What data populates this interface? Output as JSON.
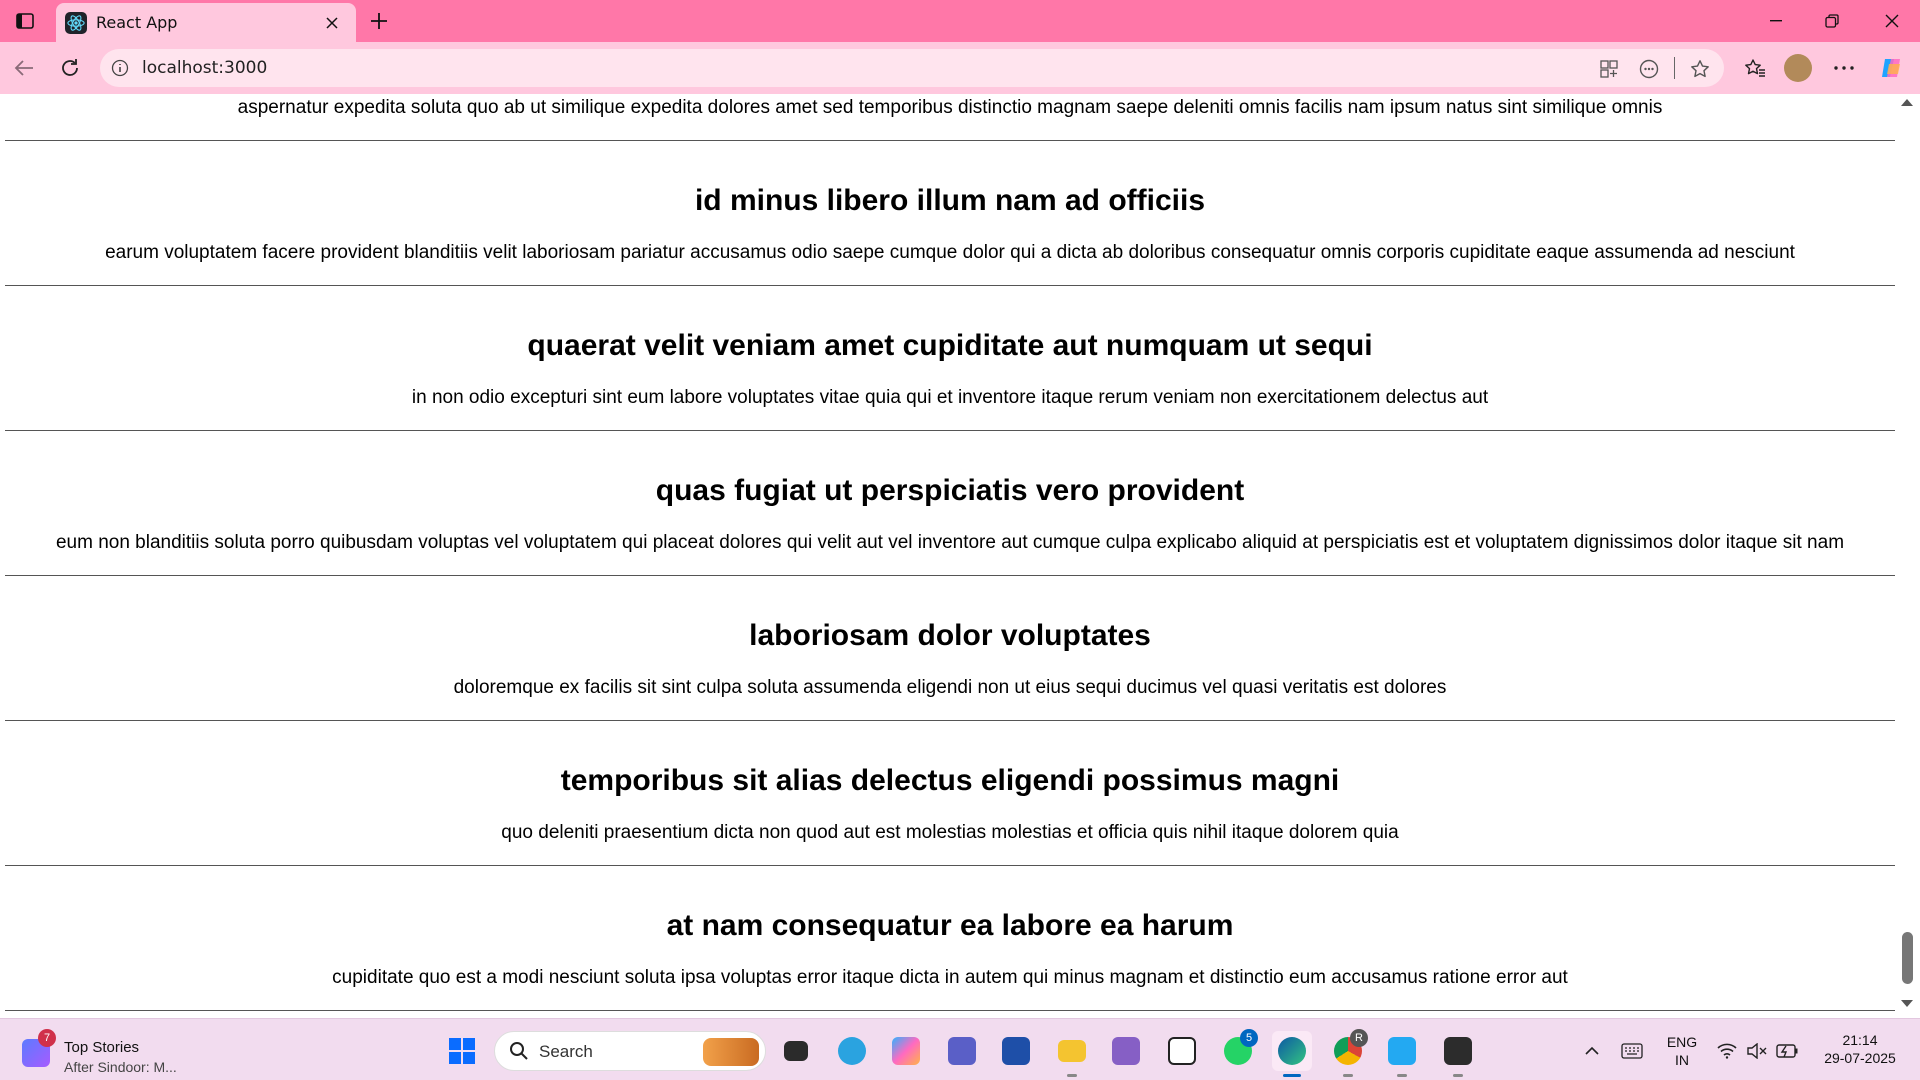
{
  "browser": {
    "tab_title": "React App",
    "url": "localhost:3000"
  },
  "posts": [
    {
      "title": "",
      "body": "aspernatur expedita soluta quo ab ut similique expedita dolores amet sed temporibus distinctio magnam saepe deleniti omnis facilis nam ipsum natus sint similique omnis"
    },
    {
      "title": "id minus libero illum nam ad officiis",
      "body": "earum voluptatem facere provident blanditiis velit laboriosam pariatur accusamus odio saepe cumque dolor qui a dicta ab doloribus consequatur omnis corporis cupiditate eaque assumenda ad nesciunt"
    },
    {
      "title": "quaerat velit veniam amet cupiditate aut numquam ut sequi",
      "body": "in non odio excepturi sint eum labore voluptates vitae quia qui et inventore itaque rerum veniam non exercitationem delectus aut"
    },
    {
      "title": "quas fugiat ut perspiciatis vero provident",
      "body": "eum non blanditiis soluta porro quibusdam voluptas vel voluptatem qui placeat dolores qui velit aut vel inventore aut cumque culpa explicabo aliquid at perspiciatis est et voluptatem dignissimos dolor itaque sit nam"
    },
    {
      "title": "laboriosam dolor voluptates",
      "body": "doloremque ex facilis sit sint culpa soluta assumenda eligendi non ut eius sequi ducimus vel quasi veritatis est dolores"
    },
    {
      "title": "temporibus sit alias delectus eligendi possimus magni",
      "body": "quo deleniti praesentium dicta non quod aut est molestias molestias et officia quis nihil itaque dolorem quia"
    },
    {
      "title": "at nam consequatur ea labore ea harum",
      "body": "cupiditate quo est a modi nesciunt soluta ipsa voluptas error itaque dicta in autem qui minus magnam et distinctio eum accusamus ratione error aut"
    }
  ],
  "taskbar": {
    "widget_badge": "7",
    "widget_title": "Top Stories",
    "widget_subtitle": "After Sindoor: M...",
    "search_label": "Search",
    "whatsapp_badge": "5",
    "chrome_badge": "R",
    "lang_top": "ENG",
    "lang_bottom": "IN",
    "time": "21:14",
    "date": "29-07-2025"
  }
}
